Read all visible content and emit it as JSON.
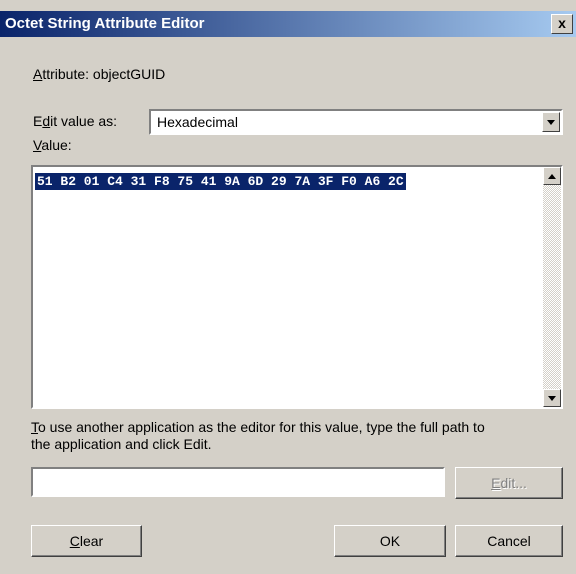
{
  "window": {
    "title": "Octet String Attribute Editor",
    "close_label": "x"
  },
  "attribute": {
    "accesskey": "A",
    "rest": "ttribute: objectGUID"
  },
  "edit_value_as": {
    "prefix": "E",
    "accesskey": "d",
    "rest": "it value as:",
    "selected": "Hexadecimal"
  },
  "value": {
    "accesskey": "V",
    "rest": "alue:",
    "hex": "51 B2 01 C4 31 F8 75 41 9A 6D 29 7A 3F F0 A6 2C"
  },
  "instructions": {
    "accesskey": "T",
    "line1_rest": "o use another application as the editor for this value, type the full path to",
    "line2": "the application and click Edit."
  },
  "path_input": {
    "value": ""
  },
  "buttons": {
    "edit": {
      "accesskey": "E",
      "rest": "dit..."
    },
    "clear": {
      "accesskey": "C",
      "rest": "lear"
    },
    "ok": "OK",
    "cancel": "Cancel"
  },
  "colors": {
    "face": "#d4d0c8",
    "title_start": "#0a246a",
    "title_end": "#a6caf0",
    "selection": "#0a246a"
  }
}
